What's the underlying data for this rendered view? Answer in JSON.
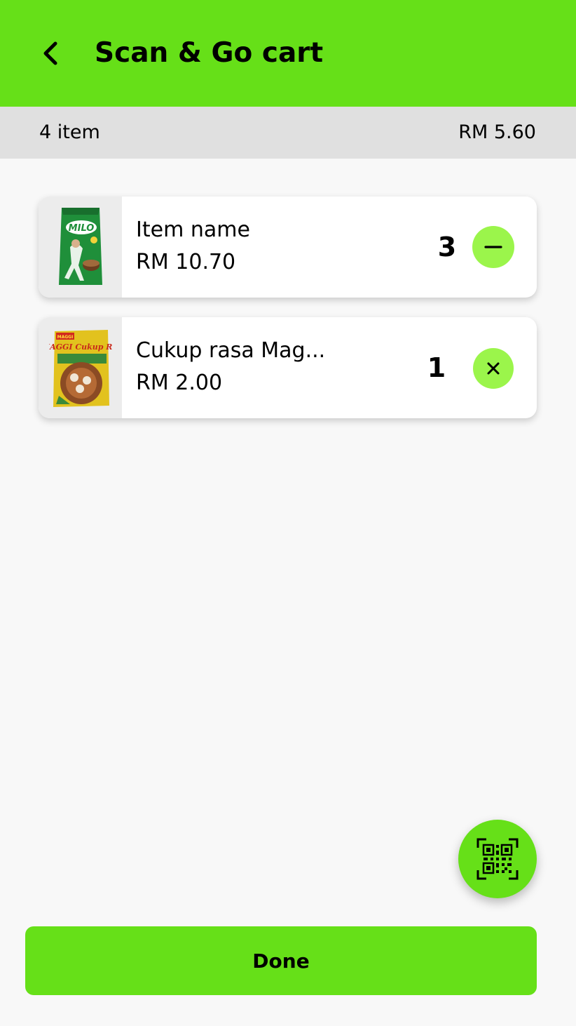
{
  "header": {
    "title": "Scan & Go cart",
    "back_icon": "chevron-left-icon",
    "background_color": "#66e018"
  },
  "summary": {
    "item_count": "4 item",
    "total": "RM 5.60"
  },
  "cart_items": [
    {
      "name": "Item name",
      "price": "RM 10.70",
      "quantity": "3",
      "action_icon": "minus-icon",
      "image_label": "MILO"
    },
    {
      "name": "Cukup rasa Mag...",
      "price": "RM 2.00",
      "quantity": "1",
      "action_icon": "close-icon",
      "image_label": "MAGGI Cukup Rasa"
    }
  ],
  "fab": {
    "icon": "qr-scan-icon",
    "color": "#66e018"
  },
  "footer": {
    "done_label": "Done",
    "color": "#66e018"
  },
  "colors": {
    "accent": "#66e018",
    "action_button": "#9bf54b",
    "summary_bar": "#e0e0e0",
    "background": "#f8f8f8"
  }
}
